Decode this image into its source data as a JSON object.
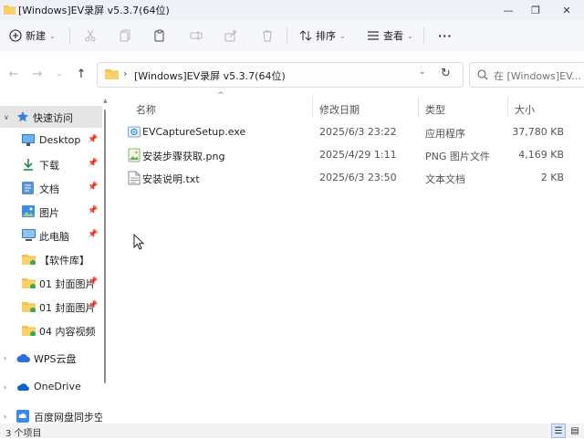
{
  "window": {
    "title": "[Windows]EV录屏 v5.3.7(64位)",
    "minimize_glyph": "—",
    "maximize_glyph": "❐",
    "close_glyph": "✕"
  },
  "toolbar": {
    "new_label": "新建",
    "sort_label": "排序",
    "view_label": "查看",
    "more_glyph": "···"
  },
  "address": {
    "path": "[Windows]EV录屏 v5.3.7(64位)",
    "separator": "›",
    "refresh_glyph": "↻"
  },
  "search": {
    "placeholder": "在 [Windows]EV..."
  },
  "sidebar": {
    "items": [
      {
        "label": "快速访问",
        "icon": "star-icon"
      },
      {
        "label": "Desktop",
        "icon": "desktop-icon"
      },
      {
        "label": "下载",
        "icon": "download-icon"
      },
      {
        "label": "文档",
        "icon": "document-icon"
      },
      {
        "label": "图片",
        "icon": "picture-icon"
      },
      {
        "label": "此电脑",
        "icon": "computer-icon"
      },
      {
        "label": "【软件库】",
        "icon": "folder-icon"
      },
      {
        "label": "01 封面图片",
        "icon": "folder-icon"
      },
      {
        "label": "01 封面图片",
        "icon": "folder-icon"
      },
      {
        "label": "04 内容视频",
        "icon": "folder-icon"
      },
      {
        "label": "WPS云盘",
        "icon": "cloud-icon"
      },
      {
        "label": "OneDrive",
        "icon": "onedrive-icon"
      },
      {
        "label": "百度网盘同步空",
        "icon": "baidu-icon"
      }
    ]
  },
  "columns": {
    "name": "名称",
    "date": "修改日期",
    "type": "类型",
    "size": "大小"
  },
  "files": [
    {
      "name": "EVCaptureSetup.exe",
      "date": "2025/6/3 23:22",
      "type": "应用程序",
      "size": "37,780 KB",
      "icon": "exe-icon"
    },
    {
      "name": "安装步骤获取.png",
      "date": "2025/4/29 1:11",
      "type": "PNG 图片文件",
      "size": "4,169 KB",
      "icon": "png-icon"
    },
    {
      "name": "安装说明.txt",
      "date": "2025/6/3 23:50",
      "type": "文本文档",
      "size": "2 KB",
      "icon": "txt-icon"
    }
  ],
  "status": {
    "count": "3 个项目"
  },
  "colors": {
    "folder": "#f5c24b",
    "accent": "#0067c0",
    "selected_bg": "#e5e5e5"
  }
}
